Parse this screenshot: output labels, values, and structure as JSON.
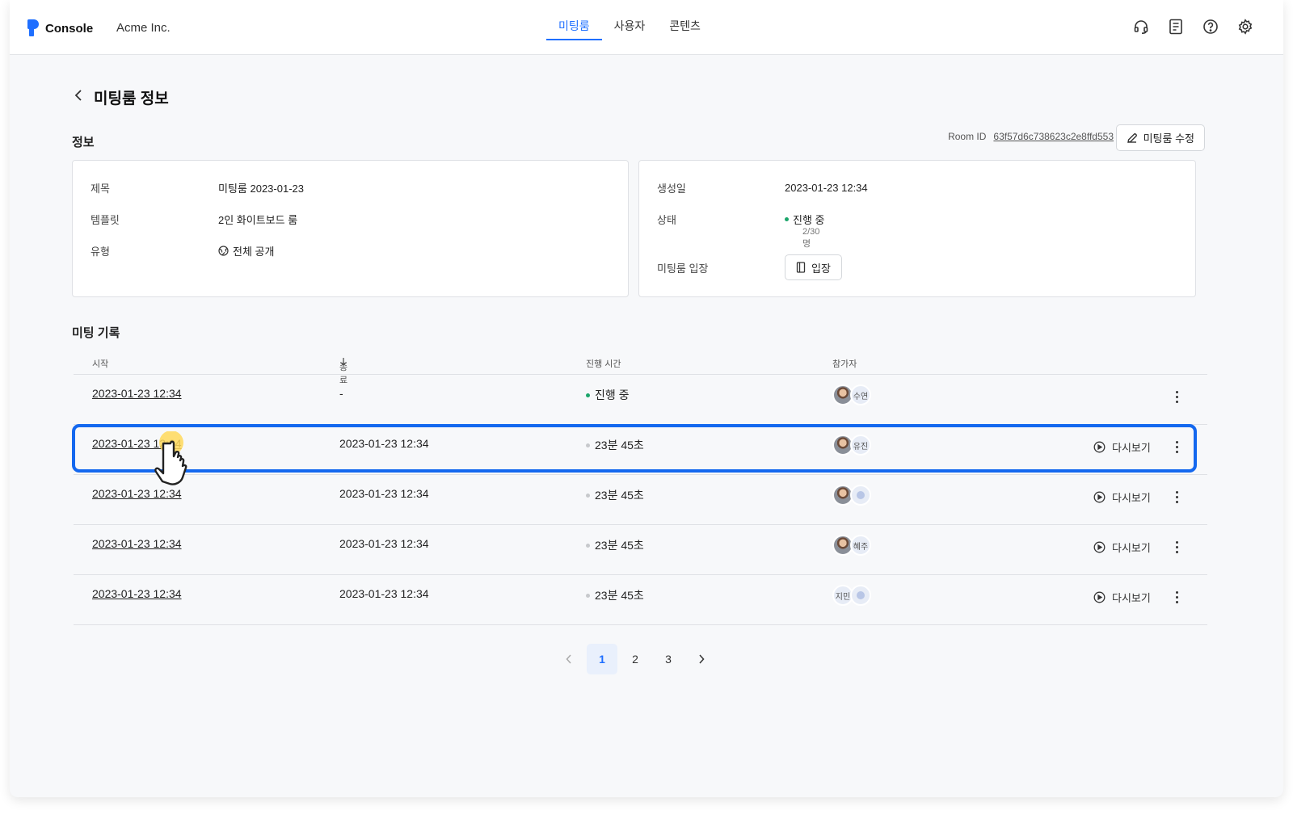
{
  "app": {
    "name": "Console",
    "org": "Acme Inc."
  },
  "nav": {
    "tabs": [
      {
        "label": "미팅룸",
        "active": true
      },
      {
        "label": "사용자"
      },
      {
        "label": "콘텐츠"
      }
    ]
  },
  "top_icons": [
    "headset-icon",
    "document-icon",
    "help-icon",
    "gear-icon"
  ],
  "page": {
    "title": "미팅룸 정보"
  },
  "info": {
    "section_title": "정보",
    "room_id_label": "Room ID",
    "room_id": "63f57d6c738623c2e8ffd553",
    "edit_label": "미팅룸 수정",
    "left": [
      {
        "key": "제목",
        "value": "미팅룸 2023-01-23"
      },
      {
        "key": "템플릿",
        "value": "2인 화이트보드 룸"
      },
      {
        "key": "유형",
        "value": "전체 공개"
      }
    ],
    "right": {
      "created_label": "생성일",
      "created": "2023-01-23 12:34",
      "status_label": "상태",
      "status": "진행 중",
      "status_sub": "2/30명",
      "enter_label": "미팅룸 입장",
      "enter_button": "입장"
    }
  },
  "records": {
    "section_title": "미팅 기록",
    "columns": {
      "start": "시작",
      "end": "종료",
      "duration": "진행 시간",
      "participants": "참가자"
    },
    "replay_label": "다시보기",
    "rows": [
      {
        "start": "2023-01-23 12:34",
        "end": "-",
        "duration": "진행 중",
        "live": true,
        "avatar_text": "수연",
        "avatar_first": "photo",
        "replay": false
      },
      {
        "start": "2023-01-23 12:34",
        "end": "2023-01-23 12:34",
        "duration": "23분 45초",
        "live": false,
        "avatar_text": "유진",
        "avatar_first": "photo",
        "replay": true
      },
      {
        "start": "2023-01-23 12:34",
        "end": "2023-01-23 12:34",
        "duration": "23분 45초",
        "live": false,
        "avatar_text": "",
        "avatar_first": "photo",
        "replay": true
      },
      {
        "start": "2023-01-23 12:34",
        "end": "2023-01-23 12:34",
        "duration": "23분 45초",
        "live": false,
        "avatar_text": "혜주",
        "avatar_first": "photo",
        "replay": true
      },
      {
        "start": "2023-01-23 12:34",
        "end": "2023-01-23 12:34",
        "duration": "23분 45초",
        "live": false,
        "avatar_text": "지민",
        "avatar_first": "text",
        "replay": true
      }
    ]
  },
  "pagination": {
    "pages": [
      "1",
      "2",
      "3"
    ],
    "current": "1"
  },
  "colors": {
    "accent": "#1f6fff",
    "highlight": "#1468ef",
    "live": "#1aa56a"
  }
}
